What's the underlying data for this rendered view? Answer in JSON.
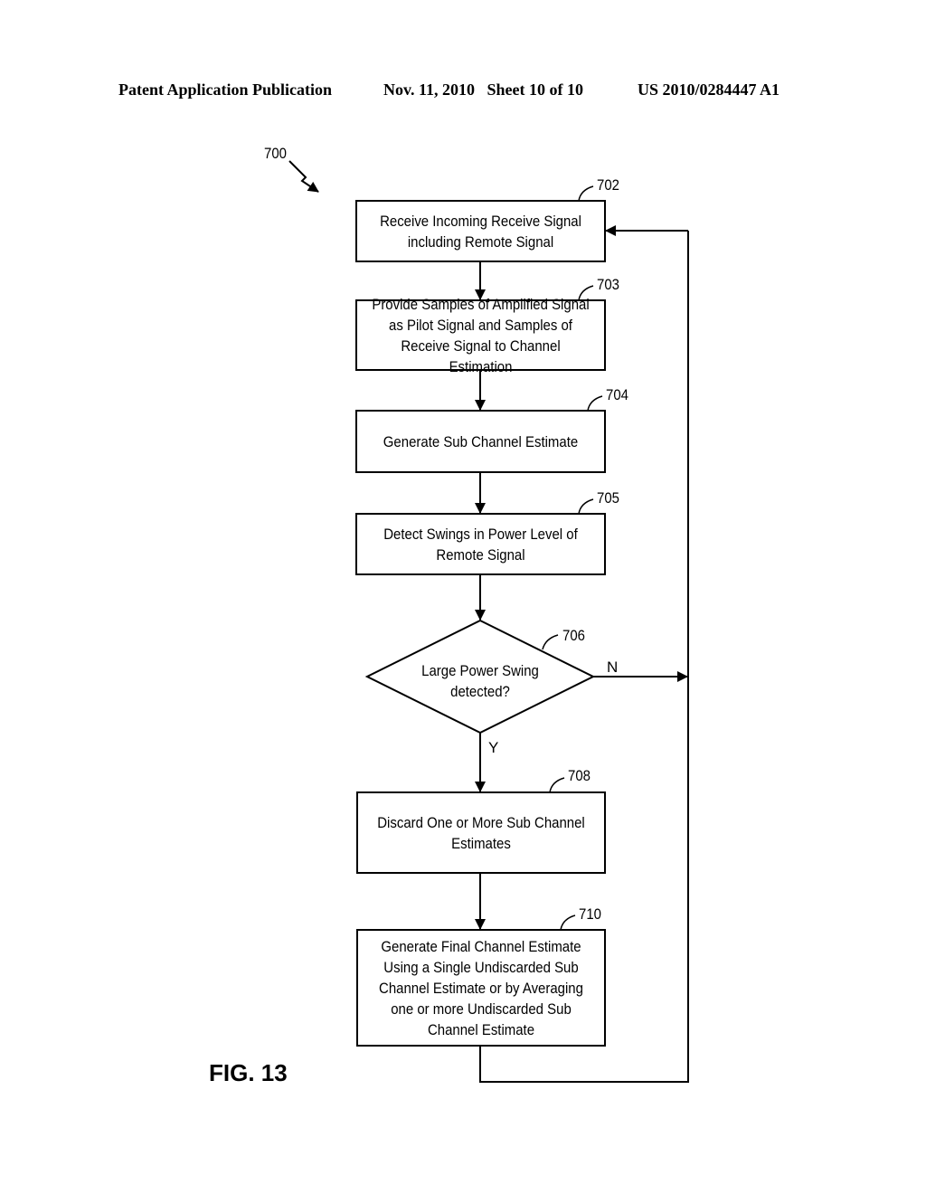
{
  "header": {
    "publication": "Patent Application Publication",
    "date_sheet": "Nov. 11, 2010   Sheet 10 of 10",
    "number": "US 2010/0284447 A1"
  },
  "figure": {
    "label": "FIG. 13",
    "ref": "700"
  },
  "steps": [
    {
      "ref": "702",
      "text": "Receive Incoming Receive Signal including Remote Signal"
    },
    {
      "ref": "703",
      "text": "Provide Samples of Amplified Signal as Pilot Signal and Samples of Receive Signal to Channel Estimation"
    },
    {
      "ref": "704",
      "text": "Generate Sub Channel Estimate"
    },
    {
      "ref": "705",
      "text": "Detect Swings in Power Level of Remote Signal"
    },
    {
      "ref": "706",
      "text": "Large Power Swing detected?"
    },
    {
      "ref": "708",
      "text": "Discard One or More Sub Channel Estimates"
    },
    {
      "ref": "710",
      "text": "Generate Final Channel Estimate Using a Single Undiscarded Sub Channel Estimate or by Averaging one or more Undiscarded Sub Channel Estimate"
    }
  ],
  "decision": {
    "yes_label": "Y",
    "no_label": "N"
  }
}
